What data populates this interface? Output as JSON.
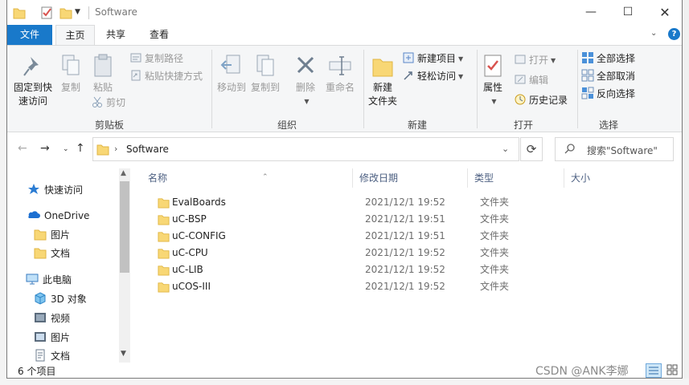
{
  "window": {
    "title": "Software"
  },
  "title_controls": {
    "minimize": "—",
    "maximize": "☐",
    "close": "✕"
  },
  "tabs": [
    {
      "label": "文件"
    },
    {
      "label": "主页"
    },
    {
      "label": "共享"
    },
    {
      "label": "查看"
    }
  ],
  "ribbon": {
    "clipboard": {
      "label": "剪贴板",
      "pin_to_quick": "固定到快\n速访问",
      "pin_line1": "固定到快",
      "pin_line2": "速访问",
      "copy": "复制",
      "paste": "粘贴",
      "copy_path": "复制路径",
      "paste_shortcut": "粘贴快捷方式",
      "cut": "剪切"
    },
    "organize": {
      "label": "组织",
      "move_to": "移动到",
      "copy_to": "复制到",
      "delete": "删除",
      "rename": "重命名"
    },
    "new": {
      "label": "新建",
      "new_folder_line1": "新建",
      "new_folder_line2": "文件夹",
      "new_item": "新建项目",
      "easy_access": "轻松访问"
    },
    "open": {
      "label": "打开",
      "properties": "属性",
      "open": "打开",
      "edit": "编辑",
      "history": "历史记录"
    },
    "select": {
      "label": "选择",
      "select_all": "全部选择",
      "select_none": "全部取消",
      "invert": "反向选择"
    }
  },
  "address": {
    "path": "Software",
    "search_placeholder": "搜索\"Software\""
  },
  "nav_pane": [
    {
      "label": "快速访问",
      "icon": "star-icon"
    },
    {
      "label": "OneDrive",
      "icon": "cloud-icon"
    },
    {
      "label": "图片",
      "icon": "folder-icon"
    },
    {
      "label": "文档",
      "icon": "folder-icon"
    },
    {
      "label": "此电脑",
      "icon": "pc-icon"
    },
    {
      "label": "3D 对象",
      "icon": "cube-icon"
    },
    {
      "label": "视频",
      "icon": "video-icon"
    },
    {
      "label": "图片",
      "icon": "pictures-icon"
    },
    {
      "label": "文档",
      "icon": "documents-icon"
    }
  ],
  "columns": {
    "name": "名称",
    "date": "修改日期",
    "type": "类型",
    "size": "大小"
  },
  "files": [
    {
      "name": "EvalBoards",
      "date": "2021/12/1 19:52",
      "type": "文件夹"
    },
    {
      "name": "uC-BSP",
      "date": "2021/12/1 19:51",
      "type": "文件夹"
    },
    {
      "name": "uC-CONFIG",
      "date": "2021/12/1 19:51",
      "type": "文件夹"
    },
    {
      "name": "uC-CPU",
      "date": "2021/12/1 19:52",
      "type": "文件夹"
    },
    {
      "name": "uC-LIB",
      "date": "2021/12/1 19:52",
      "type": "文件夹"
    },
    {
      "name": "uCOS-III",
      "date": "2021/12/1 19:52",
      "type": "文件夹"
    }
  ],
  "status": {
    "count": "6 个项目"
  },
  "watermark": "CSDN @ANK李娜",
  "colors": {
    "accent": "#1979ca",
    "folder": "#f8d775",
    "folder_dark": "#e0b643"
  }
}
